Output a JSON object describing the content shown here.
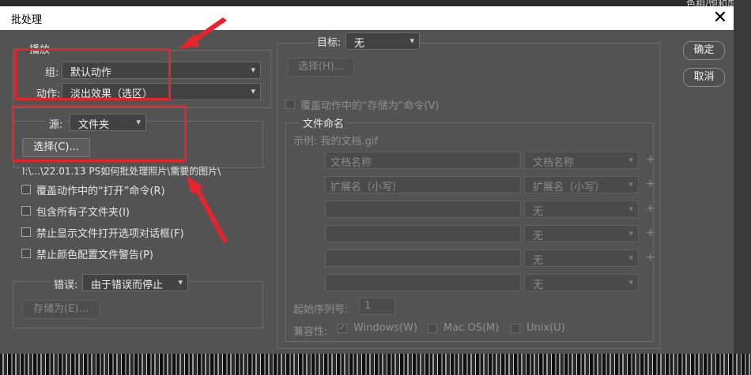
{
  "window": {
    "title": "批处理",
    "close_glyph": "✕",
    "background_text": "色相/饱和度"
  },
  "play": {
    "legend": "播放",
    "group_label": "组:",
    "group_value": "默认动作",
    "action_label": "动作:",
    "action_value": "淡出效果（选区）"
  },
  "source": {
    "label": "源:",
    "value": "文件夹",
    "choose_button": "选择(C)...",
    "path": "I:\\...\\22.01.13 PS如何批处理照片\\需要的图片\\",
    "options": [
      {
        "label": "覆盖动作中的“打开”命令(R)",
        "checked": false
      },
      {
        "label": "包含所有子文件夹(I)",
        "checked": false
      },
      {
        "label": "禁止显示文件打开选项对话框(F)",
        "checked": false
      },
      {
        "label": "禁止颜色配置文件警告(P)",
        "checked": false
      }
    ]
  },
  "errors": {
    "label": "错误:",
    "value": "由于错误而停止",
    "save_as_button": "存储为(E)..."
  },
  "destination": {
    "label": "目标:",
    "value": "无",
    "choose_button": "选择(H)...",
    "override_save_as": "覆盖动作中的“存储为”命令(V)"
  },
  "naming": {
    "legend": "文件命名",
    "example": "示例: 我的文档.gif",
    "rows": [
      {
        "field": "文档名称",
        "select": "文档名称",
        "plus": "+"
      },
      {
        "field": "扩展名（小写）",
        "select": "扩展名（小写）",
        "plus": "+"
      },
      {
        "field": "",
        "select": "无",
        "plus": "+"
      },
      {
        "field": "",
        "select": "无",
        "plus": "+"
      },
      {
        "field": "",
        "select": "无",
        "plus": "+"
      },
      {
        "field": "",
        "select": "无",
        "plus": ""
      }
    ],
    "start_serial_label": "起始序列号:",
    "start_serial_value": "1",
    "compat_label": "兼容性:",
    "compat": [
      {
        "label": "Windows(W)",
        "checked": true
      },
      {
        "label": "Mac OS(M)",
        "checked": false
      },
      {
        "label": "Unix(U)",
        "checked": false
      }
    ]
  },
  "buttons": {
    "ok": "确定",
    "cancel": "取消"
  },
  "icons": {
    "dropdown": "chevron-down-icon",
    "close": "close-icon",
    "check": "checkmark-icon",
    "add": "plus-icon"
  },
  "colors": {
    "dialog_bg": "#535353",
    "annotation_red": "#e8232b",
    "titlebar": "#ffffff"
  }
}
